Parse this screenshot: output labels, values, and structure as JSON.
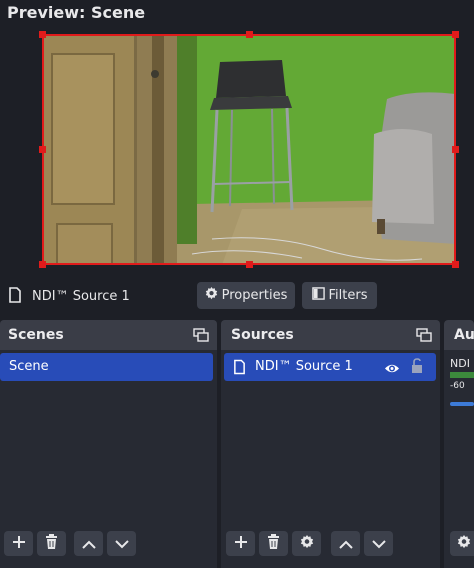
{
  "preview": {
    "title": "Preview: Scene"
  },
  "source_toolbar": {
    "source_name": "NDI™ Source 1",
    "properties_label": "Properties",
    "filters_label": "Filters"
  },
  "scenes": {
    "title": "Scenes",
    "items": [
      {
        "label": "Scene",
        "selected": true
      }
    ]
  },
  "sources": {
    "title": "Sources",
    "items": [
      {
        "label": "NDI™ Source 1",
        "visible": true,
        "locked": false,
        "selected": true
      }
    ]
  },
  "audio_mixer": {
    "title": "Au",
    "channel_label": "NDI",
    "meter_tick": "-60"
  },
  "colors": {
    "selection": "#284cb8",
    "transform_border": "#e01b1b",
    "panel": "#272a33",
    "panel_header": "#3a3d47"
  }
}
